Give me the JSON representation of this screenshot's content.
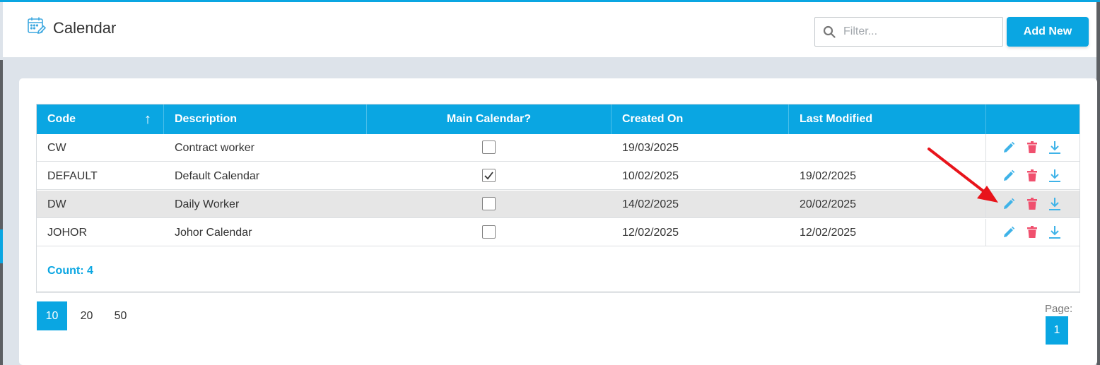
{
  "header": {
    "title": "Calendar",
    "filter_placeholder": "Filter...",
    "add_button": "Add New"
  },
  "table": {
    "columns": [
      "Code",
      "Description",
      "Main Calendar?",
      "Created On",
      "Last Modified",
      ""
    ],
    "sort": {
      "column": "Code",
      "direction": "ascending"
    },
    "rows": [
      {
        "code": "CW",
        "description": "Contract worker",
        "main": false,
        "created": "19/03/2025",
        "modified": ""
      },
      {
        "code": "DEFAULT",
        "description": "Default Calendar",
        "main": true,
        "created": "10/02/2025",
        "modified": "19/02/2025"
      },
      {
        "code": "DW",
        "description": "Daily Worker",
        "main": false,
        "created": "14/02/2025",
        "modified": "20/02/2025"
      },
      {
        "code": "JOHOR",
        "description": "Johor Calendar",
        "main": false,
        "created": "12/02/2025",
        "modified": "12/02/2025"
      }
    ],
    "selected_row": 2,
    "count_label": "Count: 4",
    "row_actions": [
      "pencil-icon",
      "trash-icon",
      "download-icon"
    ]
  },
  "pagination": {
    "page_sizes": [
      "10",
      "20",
      "50"
    ],
    "active_page_size": "10",
    "page_label": "Page:",
    "current_page": "1"
  },
  "colors": {
    "accent": "#0aa6e2",
    "delete": "#f0506e",
    "edit": "#3fb3e8",
    "annotation_arrow": "#e8141b"
  }
}
